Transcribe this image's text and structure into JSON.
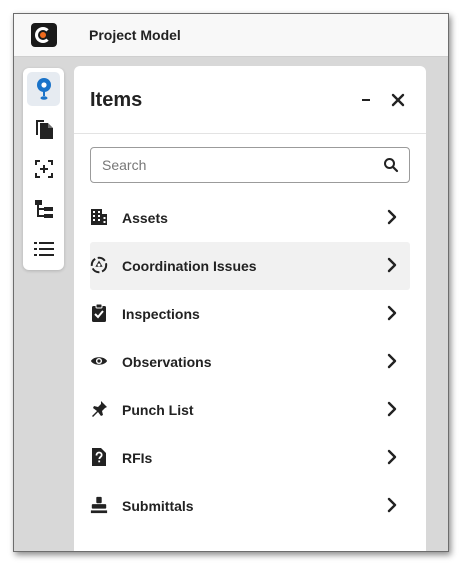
{
  "app": {
    "title": "Project Model",
    "accent": "#1a73c9",
    "logo_accent": "#f26b1d"
  },
  "rail": {
    "items": [
      {
        "name": "location-pin-icon",
        "active": true
      },
      {
        "name": "documents-icon",
        "active": false
      },
      {
        "name": "focus-frame-icon",
        "active": false
      },
      {
        "name": "tree-hierarchy-icon",
        "active": false
      },
      {
        "name": "list-icon",
        "active": false
      }
    ]
  },
  "panel": {
    "title": "Items",
    "minimize_label": "–",
    "close_label": "✕",
    "search": {
      "placeholder": "Search",
      "value": ""
    },
    "items": [
      {
        "label": "Assets",
        "icon": "building-icon"
      },
      {
        "label": "Coordination Issues",
        "icon": "coordination-issues-icon",
        "highlighted": true
      },
      {
        "label": "Inspections",
        "icon": "clipboard-check-icon"
      },
      {
        "label": "Observations",
        "icon": "eye-icon"
      },
      {
        "label": "Punch List",
        "icon": "pushpin-icon"
      },
      {
        "label": "RFIs",
        "icon": "question-document-icon"
      },
      {
        "label": "Submittals",
        "icon": "stamp-icon"
      }
    ]
  }
}
